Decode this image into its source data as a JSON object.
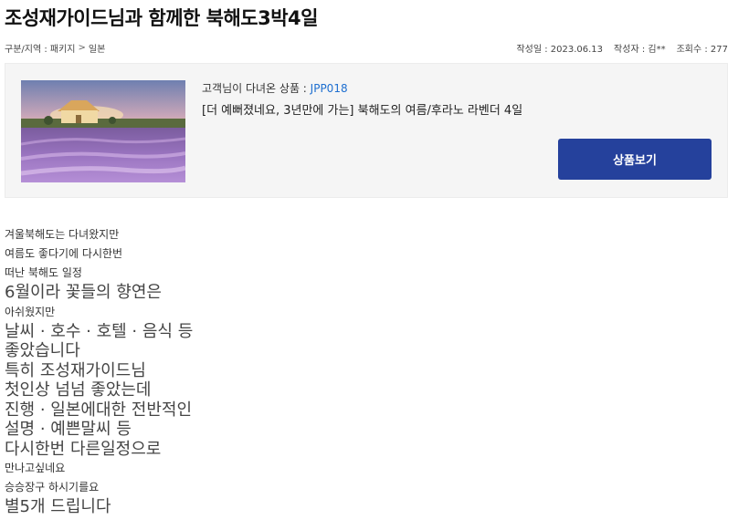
{
  "title": "조성재가이드님과 함께한 북해도3박4일",
  "meta": {
    "category_label": "구분/지역 : 패키지",
    "separator": ">",
    "region": "일본",
    "date": "작성일 : 2023.06.13",
    "author": "작성자 : 김**",
    "views": "조회수 : 277"
  },
  "product": {
    "code_label": "고객님이 다녀온 상품 : ",
    "code": "JPP018",
    "name": "[더 예뻐졌네요, 3년만에 가는] 북해도의 여름/후라노 라벤더 4일",
    "view_button": "상품보기"
  },
  "review_lines": [
    {
      "text": "겨울북해도는 다녀왔지만",
      "size": "sm"
    },
    {
      "text": "여름도 좋다기에 다시한번",
      "size": "sm"
    },
    {
      "text": "떠난 북해도 일정",
      "size": "sm"
    },
    {
      "text": "6월이라 꽃들의 향연은",
      "size": "lg"
    },
    {
      "text": "아쉬웠지만",
      "size": "sm"
    },
    {
      "text": "날씨 · 호수 · 호텔 · 음식 등",
      "size": "lg"
    },
    {
      "text": "좋았습니다",
      "size": "lg"
    },
    {
      "text": "특히 조성재가이드님",
      "size": "lg"
    },
    {
      "text": "첫인상 넘넘 좋았는데",
      "size": "lg"
    },
    {
      "text": "진행 · 일본에대한 전반적인",
      "size": "lg"
    },
    {
      "text": "설명 · 예쁜말씨 등",
      "size": "lg"
    },
    {
      "text": "다시한번 다른일정으로",
      "size": "lg"
    },
    {
      "text": "만나고싶네요",
      "size": "sm"
    },
    {
      "text": "승승장구 하시기를요",
      "size": "sm"
    },
    {
      "text": "별5개 드립니다",
      "size": "lg"
    }
  ],
  "colors": {
    "button_bg": "#25419c",
    "code_link": "#1e6fd0"
  }
}
